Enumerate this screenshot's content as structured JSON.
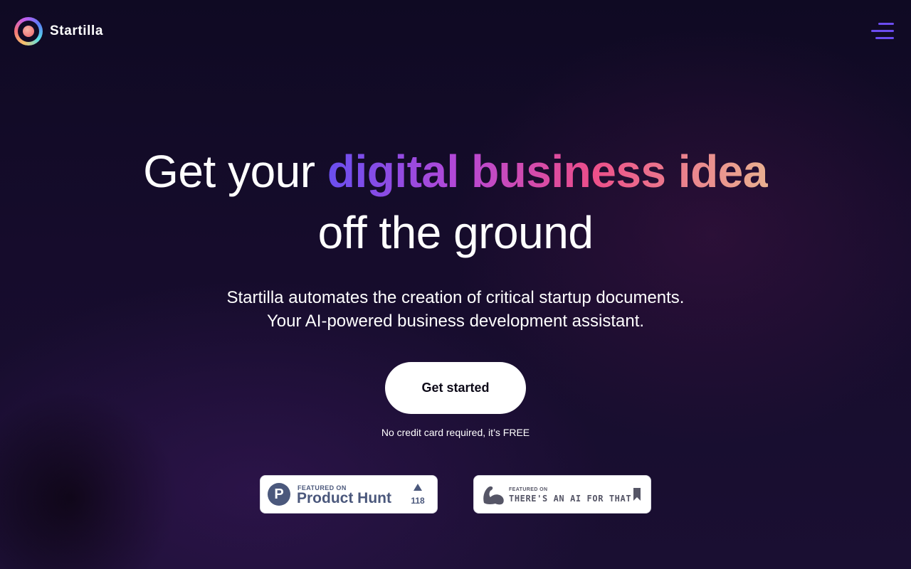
{
  "header": {
    "brand_name": "Startilla",
    "logo_icon": "startilla-logo-icon",
    "menu_icon": "hamburger-menu-icon"
  },
  "hero": {
    "title_prefix": "Get your ",
    "title_highlight": "digital business idea",
    "title_line2": "off the ground",
    "subtitle_line1": "Startilla automates the creation of critical startup documents.",
    "subtitle_line2": "Your AI-powered business development assistant.",
    "cta_label": "Get started",
    "cta_note": "No credit card required, it’s FREE"
  },
  "badges": {
    "product_hunt": {
      "featured_label": "FEATURED ON",
      "name": "Product Hunt",
      "logo_letter": "P",
      "upvote_count": "118"
    },
    "taaft": {
      "featured_label": "FEATURED ON",
      "name": "THERE'S AN AI FOR THAT"
    }
  },
  "colors": {
    "background": "#120b26",
    "accent_purple": "#6b4cf0",
    "gradient_start": "#6a4ff0",
    "gradient_mid": "#ec4e8a",
    "gradient_end": "#e9b090",
    "cta_background": "#ffffff",
    "product_hunt_slate": "#4b587c"
  }
}
